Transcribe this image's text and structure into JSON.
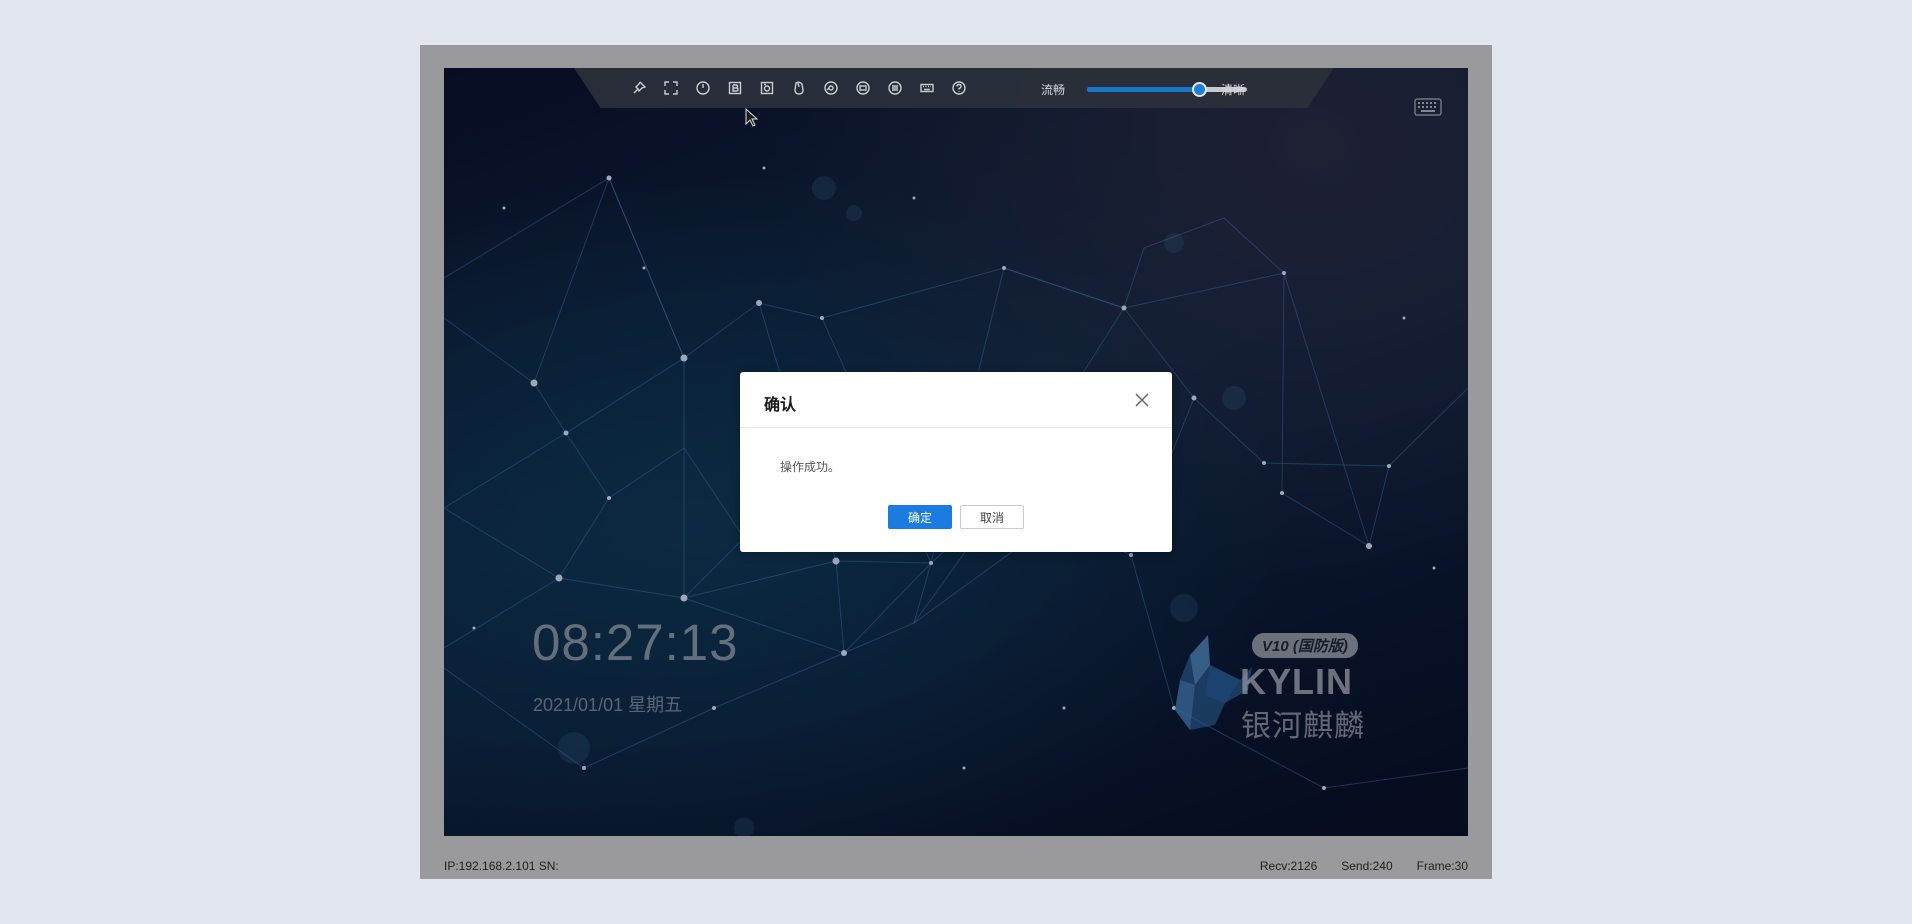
{
  "toolbar": {
    "icons": [
      "pin-icon",
      "fullscreen-icon",
      "power-icon",
      "b-icon",
      "screenshot-icon",
      "mouse-icon",
      "disc-icon",
      "record-icon",
      "menu-icon",
      "keyboard-icon",
      "help-icon"
    ],
    "quality_low_label": "流畅",
    "quality_high_label": "清晰",
    "quality_level_percent": 70,
    "accent_color": "#1677c9"
  },
  "desktop": {
    "clock": "08:27:13",
    "date": "2021/01/01 星期五",
    "logo_badge": "V10 (国防版)",
    "logo_brand": "KYLIN",
    "logo_brand_cn": "银河麒麟"
  },
  "dialog": {
    "title": "确认",
    "message": "操作成功。",
    "ok_label": "确定",
    "cancel_label": "取消",
    "ok_color": "#1b7be0"
  },
  "status_bar": {
    "ip_sn": "IP:192.168.2.101 SN:",
    "recv": "Recv:2126",
    "send": "Send:240",
    "frame": "Frame:30"
  }
}
